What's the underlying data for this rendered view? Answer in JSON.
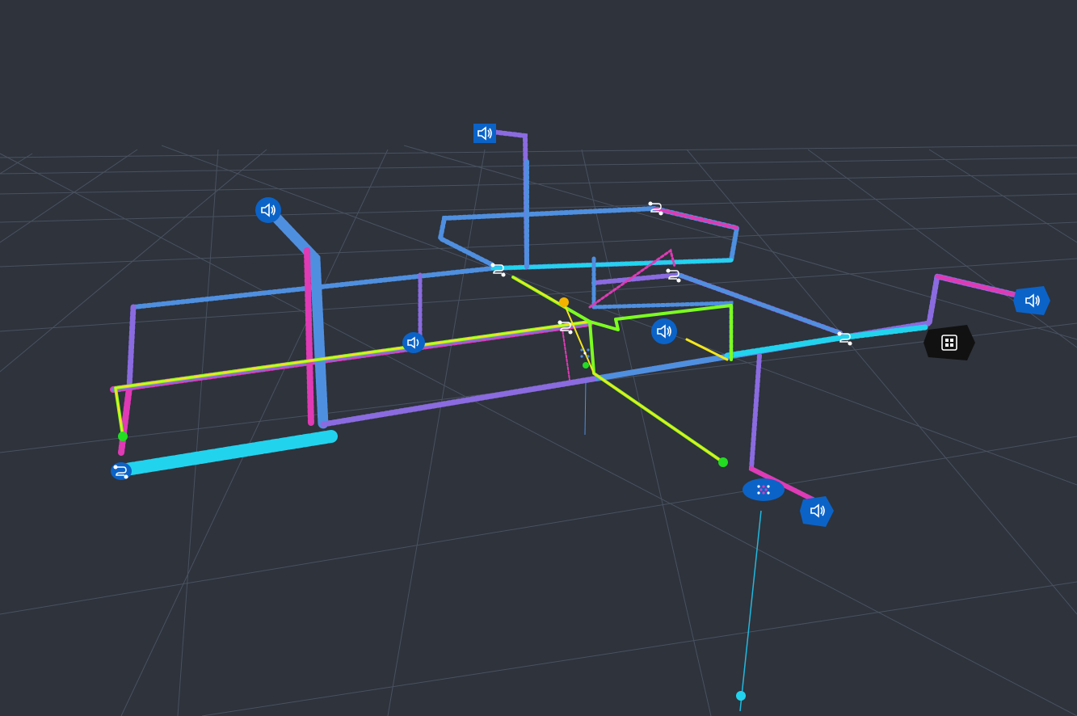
{
  "viewer": {
    "title": "",
    "colors": {
      "background": "#2e333c",
      "grid": "#4a5260",
      "cyan": "#22d3ee",
      "blue": "#4f8fe0",
      "violet": "#8b6be0",
      "magenta": "#e03ab5",
      "lime": "#7cff1f",
      "yellow": "#f5e71a",
      "node_blue": "#0b63c8",
      "node_black": "#111111",
      "orange": "#f5b300",
      "green_dot": "#22dd22"
    },
    "icons": {
      "speaker": "speaker-icon",
      "route": "route-icon",
      "grid_menu": "grid-menu-icon",
      "splitter": "splitter-icon"
    }
  }
}
